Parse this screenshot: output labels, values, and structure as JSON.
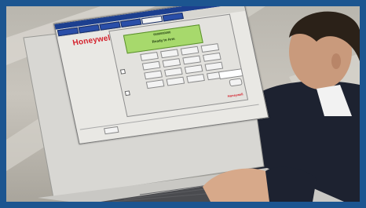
{
  "photo": {
    "description_icon": "person-using-laptop-photo"
  },
  "screen": {
    "logo": "Honeywell",
    "status_line1": "0000000000",
    "status_line2": "Ready to Arm",
    "brand_small": "Honeywell"
  },
  "colors": {
    "frame": "#1c5590",
    "status_green": "#a7d96c",
    "brand_red": "#d4202b",
    "tab_blue": "#2a4ea8"
  }
}
